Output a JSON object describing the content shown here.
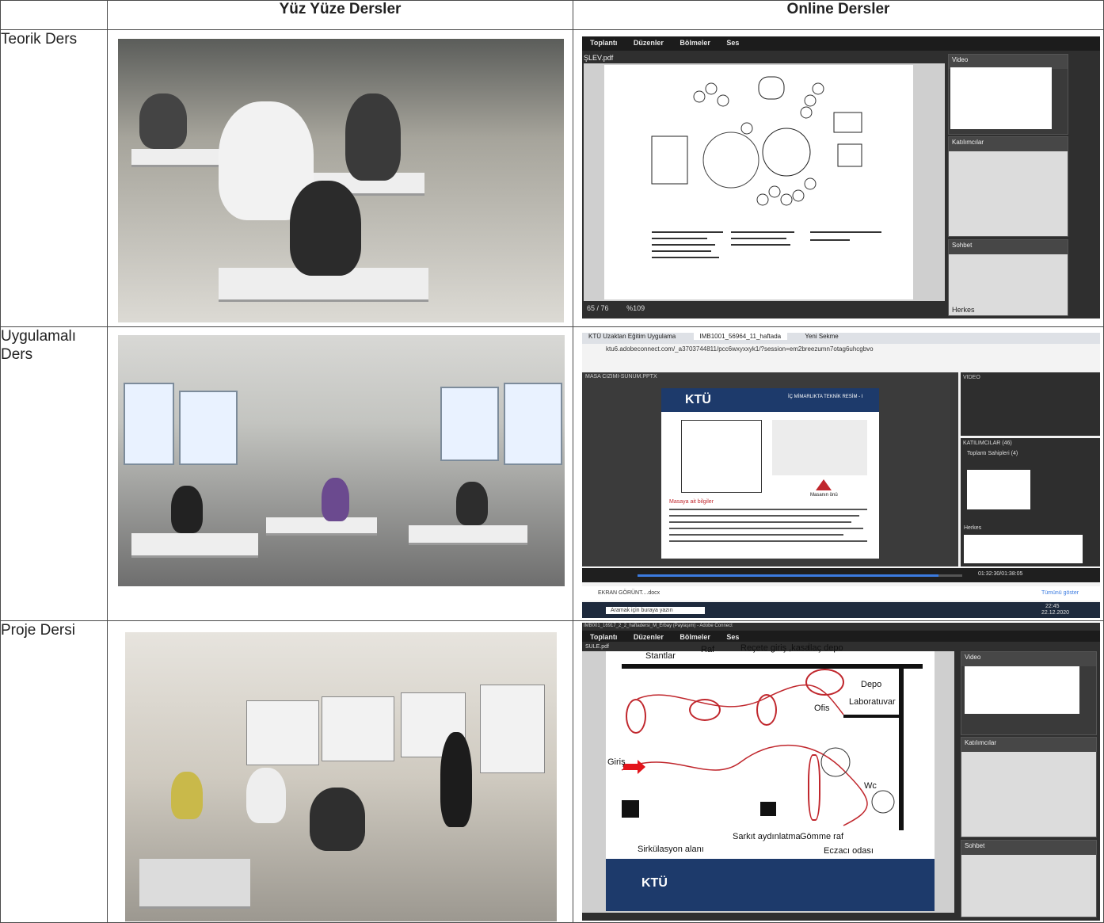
{
  "headers": {
    "col1": "",
    "col2": "Yüz Yüze Dersler",
    "col3": "Online Dersler"
  },
  "rows": [
    {
      "label": "Teorik Ders"
    },
    {
      "label": "Uygulamalı Ders"
    },
    {
      "label": "Proje Dersi"
    }
  ],
  "screen1": {
    "menu": [
      "Toplantı",
      "Düzenler",
      "Bölmeler",
      "Ses"
    ],
    "file": "ŞLEV.pdf",
    "panel_video": "Video",
    "panel_participants": "Katılımcılar",
    "panel_chat": "Sohbet",
    "chat_target": "Herkes",
    "page": "65",
    "pages": "/ 76",
    "zoom": "%109"
  },
  "screen2": {
    "tab1": "KTÜ Uzaktan Eğitim Uygulama",
    "tab2": "IMB1001_56964_11_haftada",
    "tab3": "Yeni Sekme",
    "url": "ktu6.adobeconnect.com/_a3703744811/pcc6wxyxxyk1/?session=em2breezumn7otag6uhcgbvo",
    "file": "MASA CIZIMI-SUNUM.PPTX",
    "slide_title": "İÇ MİMARLIKTA TEKNİK RESİM - I",
    "slide_heading": "Masaya ait bilgiler",
    "slide_caption": "Masanın önü",
    "panel_video": "VIDEO",
    "panel_participants": "KATILIMCILAR (46)",
    "hosts": "Toplantı Sahipleri (4)",
    "chat_target": "Herkes",
    "time": "01:32:30/01:38:05",
    "download": "EKRAN GÖRÜNT....docx",
    "show_all": "Tümünü göster",
    "search": "Aramak için buraya yazın",
    "clock": "22:45",
    "date": "22.12.2020"
  },
  "screen3": {
    "title": "IMB001_16917_2_2_haftadersi_M_Erbay (Paylaşım) - Adobe Connect",
    "menu": [
      "Toplantı",
      "Düzenler",
      "Bölmeler",
      "Ses"
    ],
    "file": "SULE.pdf",
    "labels": {
      "stantlar": "Stantlar",
      "raf": "Raf",
      "recete": "Reçete giriş ,kasa",
      "ilac": "İlaç depo",
      "depo": "Depo",
      "ofis": "Ofis",
      "lab": "Laboratuvar",
      "giris": "Giriş",
      "wc": "Wc",
      "sirk": "Sirkülasyon alanı",
      "sarkit": "Sarkıt aydınlatma",
      "gomme": "Gömme raf",
      "eczaci": "Eczacı odası"
    },
    "logo": "KTÜ",
    "panel_video": "Video",
    "panel_participants": "Katılımcılar",
    "panel_chat": "Sohbet"
  },
  "colors": {
    "border": "#4a4a4a",
    "slide_blue": "#1d3a6b",
    "red": "#c0272d",
    "progress": "#3b7be0"
  }
}
